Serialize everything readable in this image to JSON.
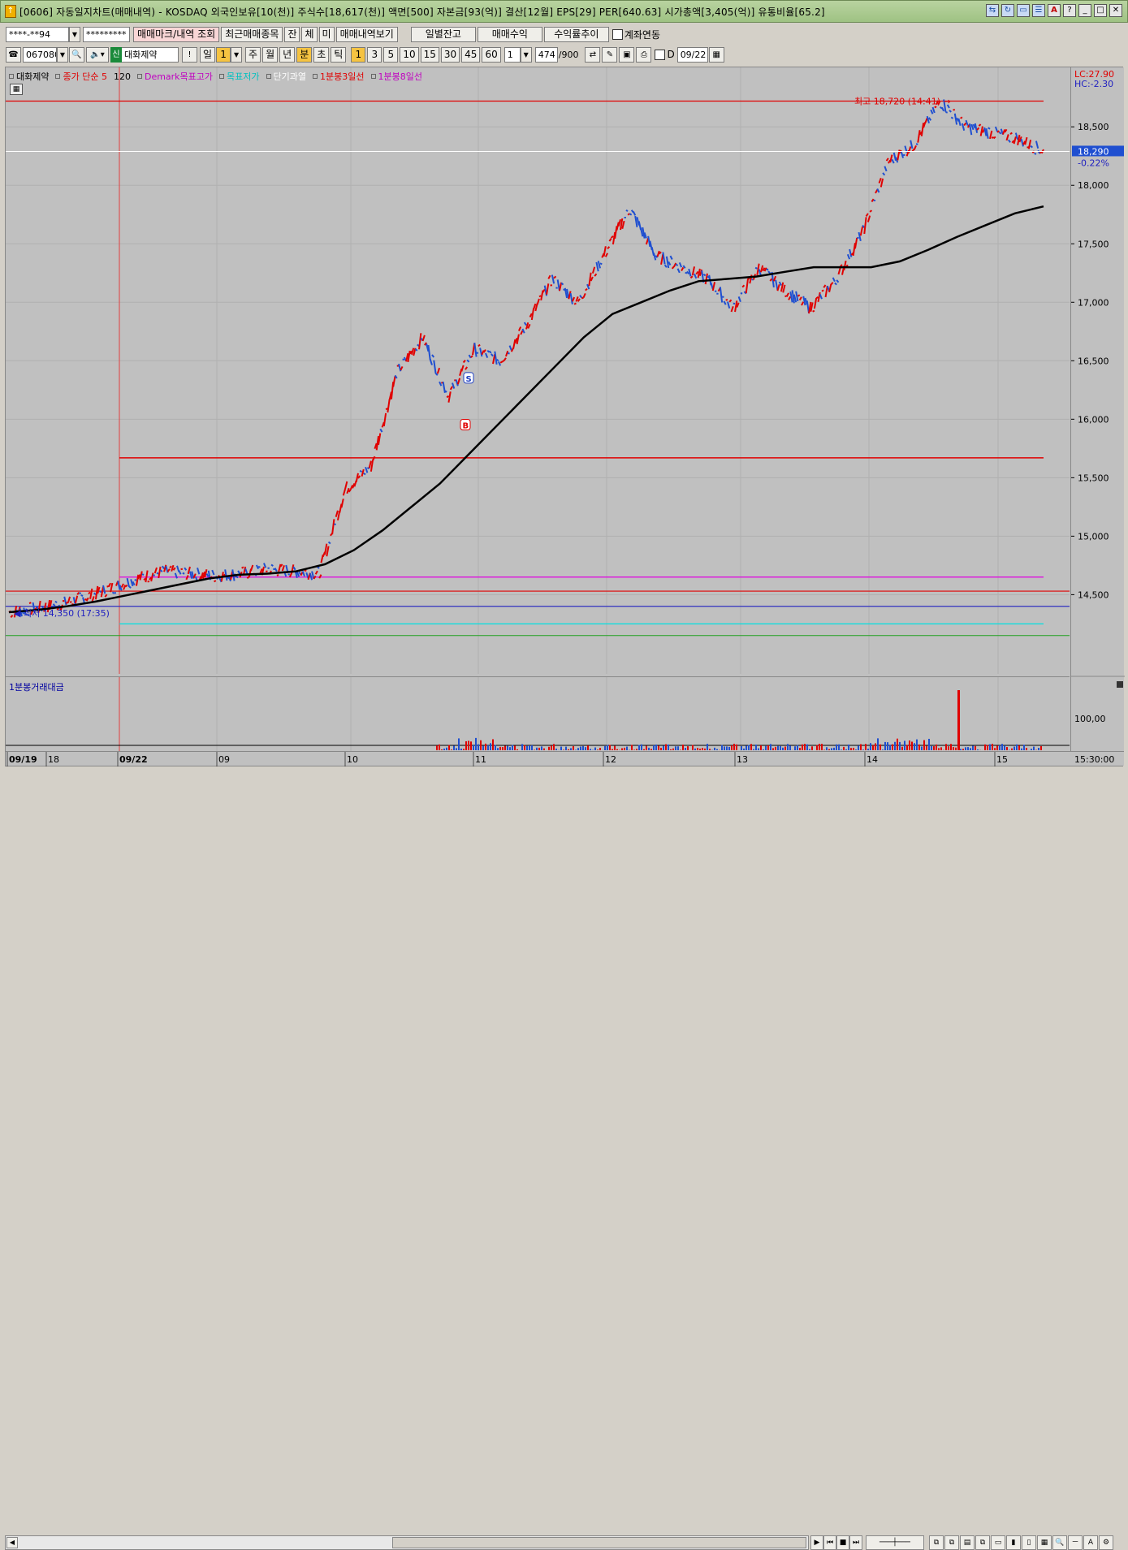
{
  "window": {
    "title": "[0606] 자동일지차트(매매내역) - KOSDAQ 외국인보유[10(천)] 주식수[18,617(천)] 액면[500] 자본금[93(억)] 결산[12월] EPS[29] PER[640.63] 시가총액[3,405(억)] 유통비율[65.2]",
    "icon": "app-icon"
  },
  "toolbar1": {
    "account_value": "****-**94",
    "password_value": "*********",
    "buttons": [
      "매매마크/내역 조회",
      "최근매매종목",
      "잔",
      "체",
      "미",
      "매매내역보기"
    ],
    "buttons_right": [
      "일별잔고",
      "매매수익",
      "수익률추이"
    ],
    "linked_label": "계좌연동"
  },
  "toolbar2": {
    "code": "067080",
    "badge": "신",
    "stock_name": "대화제약",
    "period_buttons": [
      "일",
      "1",
      "주",
      "월",
      "년",
      "분",
      "초",
      "틱"
    ],
    "minute_buttons": [
      "1",
      "3",
      "5",
      "10",
      "15",
      "30",
      "45",
      "60"
    ],
    "interval_value": "1",
    "count_value": "474",
    "count_total": "/900",
    "d_label": "D",
    "date_value": "09/22"
  },
  "legend": [
    {
      "label": "대화제약",
      "color": "#000000"
    },
    {
      "label": "종가 단순 5",
      "color": "#e00000"
    },
    {
      "label": "120",
      "color": "#000000"
    },
    {
      "label": "Demark목표고가",
      "color": "#c000c0"
    },
    {
      "label": "목표저가",
      "color": "#00c0c0"
    },
    {
      "label": "단기과열",
      "color": "#ffffff"
    },
    {
      "label": "1분봉3일선",
      "color": "#e00000"
    },
    {
      "label": "1분봉8일선",
      "color": "#c000c0"
    }
  ],
  "axis": {
    "lc": "LC:27.90",
    "hc": "HC:-2.30",
    "price_ticks": [
      "18,500",
      "18,000",
      "17,500",
      "17,000",
      "16,500",
      "16,000",
      "15,500",
      "15,000",
      "14,500"
    ],
    "current_price": "18,290",
    "current_change": "-0.22%",
    "vol_tick": "100,00",
    "time_label": "15:30:00"
  },
  "annotations": {
    "high": "최고 18,720 (14:41)",
    "low": "최저 14,350 (17:35)",
    "buy_mark": "B",
    "sell_mark": "S"
  },
  "volume_label": "1분봉거래대금",
  "dates": [
    "09/19",
    "18",
    "09/22",
    "09",
    "10",
    "11",
    "12",
    "13",
    "14",
    "15"
  ],
  "colors": {
    "up": "#e00000",
    "down": "#1f4fd0",
    "ma120": "#000000",
    "demark_high": "#e000e0",
    "target_low": "#00e0e0"
  },
  "chart_data": {
    "type": "line",
    "title": "",
    "ylim": [
      14100,
      18800
    ],
    "series": [
      {
        "values": [
          14350,
          14380,
          14420,
          14480,
          14560,
          14640,
          14700,
          14680,
          14660,
          14680,
          14720,
          14700,
          14680,
          15400,
          15600,
          16400,
          16700,
          16200,
          16600,
          16500,
          16800,
          17200,
          17000,
          17400,
          17800,
          17400,
          17300,
          17200,
          16950,
          17300,
          17100,
          16950,
          17200,
          17600,
          18200,
          18350,
          18720,
          18500,
          18450,
          18400,
          18290
        ]
      },
      {
        "name": "120",
        "values": [
          14350,
          14370,
          14400,
          14440,
          14490,
          14540,
          14590,
          14640,
          14670,
          14680,
          14700,
          14760,
          14880,
          15050,
          15250,
          15450,
          15700,
          15950,
          16200,
          16450,
          16700,
          16900,
          17000,
          17100,
          17180,
          17200,
          17220,
          17260,
          17300,
          17300,
          17300,
          17350,
          17450,
          17560,
          17660,
          17760,
          17820
        ]
      }
    ],
    "hlines": [
      18720,
      15670,
      14650,
      14530,
      14400,
      14250
    ]
  }
}
